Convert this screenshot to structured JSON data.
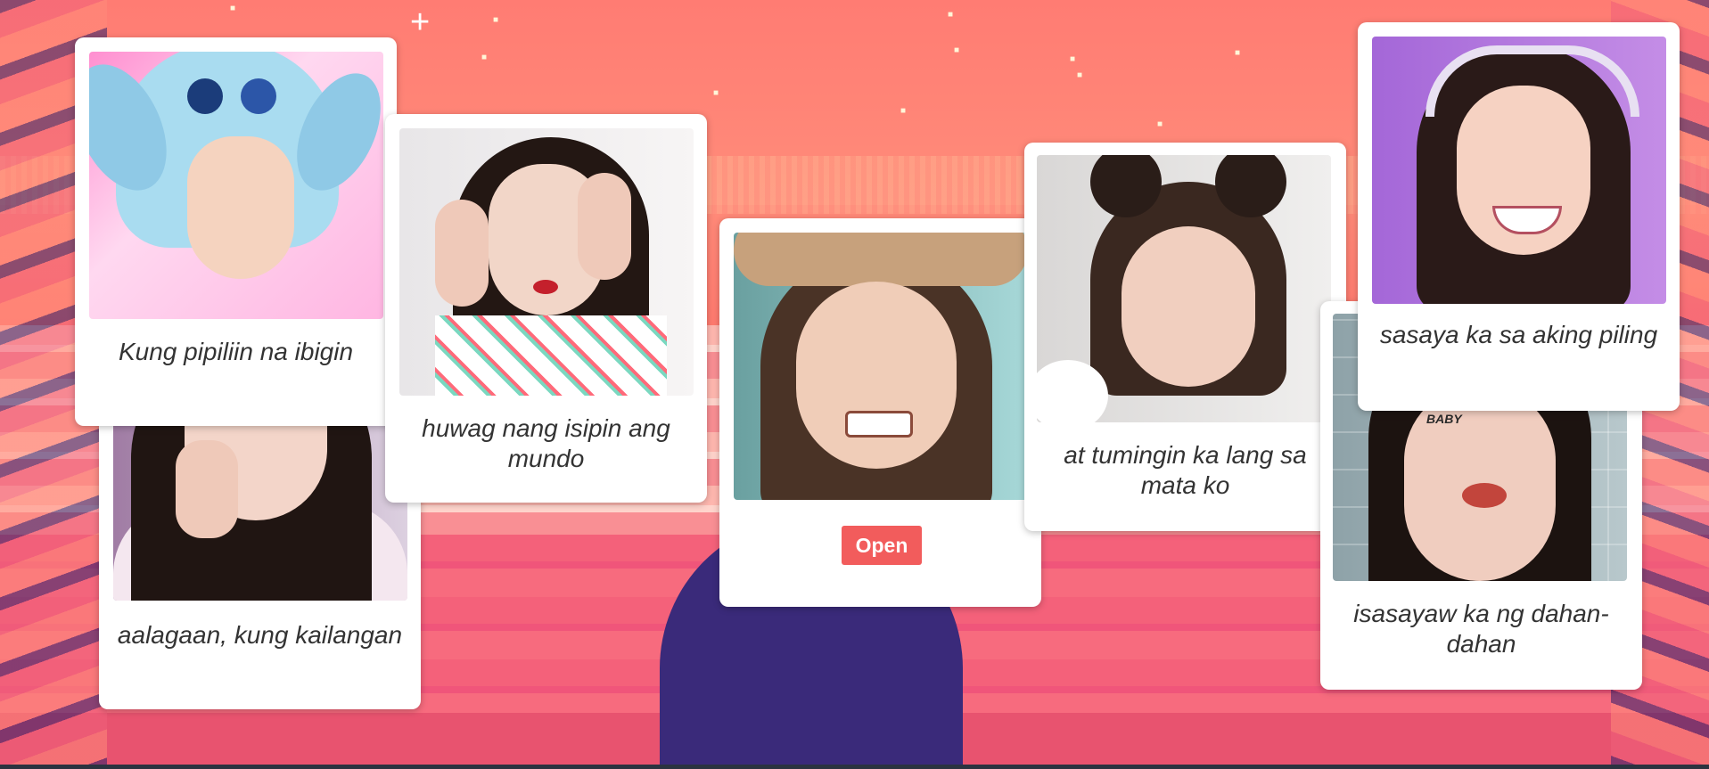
{
  "cards": [
    {
      "caption": "Kung pipiliin na ibigin",
      "photo_icon": "photo-blue-hat"
    },
    {
      "caption": "aalagaan, kung kailangan",
      "photo_icon": "photo-pout-sparkles"
    },
    {
      "caption": "huwag nang isipin ang mundo",
      "photo_icon": "photo-heart-hands"
    },
    {
      "caption": "",
      "photo_icon": "photo-bear-ears",
      "button_label": "Open"
    },
    {
      "caption": "at tumingin ka lang sa mata ko",
      "photo_icon": "photo-hair-buns"
    },
    {
      "caption": "isasayaw ka ng dahan-dahan",
      "photo_icon": "photo-baby-tattoo",
      "tattoo_text": "BABY"
    },
    {
      "caption": "sasaya ka sa aking piling",
      "photo_icon": "photo-purple-smile"
    }
  ],
  "colors": {
    "background": "#ff7f74",
    "card": "#ffffff",
    "button": "#f25c5c",
    "caption_text": "#333333"
  }
}
